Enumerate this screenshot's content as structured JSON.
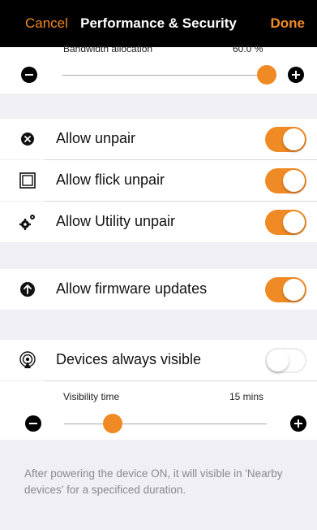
{
  "nav": {
    "cancel": "Cancel",
    "title": "Performance & Security",
    "done": "Done"
  },
  "bandwidth": {
    "label": "Bandwidth allocation",
    "value_text": "60.0 %",
    "level_fraction": 1.0
  },
  "security_rows": [
    {
      "label": "Allow unpair",
      "icon": "x-circle-icon",
      "on": true
    },
    {
      "label": "Allow flick unpair",
      "icon": "square-icon",
      "on": true
    },
    {
      "label": "Allow Utility unpair",
      "icon": "gears-icon",
      "on": true
    }
  ],
  "firmware_row": {
    "label": "Allow firmware updates",
    "icon": "arrow-up-circle-icon",
    "on": true
  },
  "visibility_row": {
    "label": "Devices always visible",
    "icon": "broadcast-icon",
    "on": false
  },
  "visibility_time": {
    "label": "Visibility time",
    "value_text": "15 mins",
    "level_fraction": 0.24
  },
  "footer_note": "After powering the device ON, it will visible in 'Nearby devices' for a specificed duration.",
  "colors": {
    "accent": "#f08a24",
    "nav_bg": "#000000",
    "group_bg": "#efeff4"
  }
}
